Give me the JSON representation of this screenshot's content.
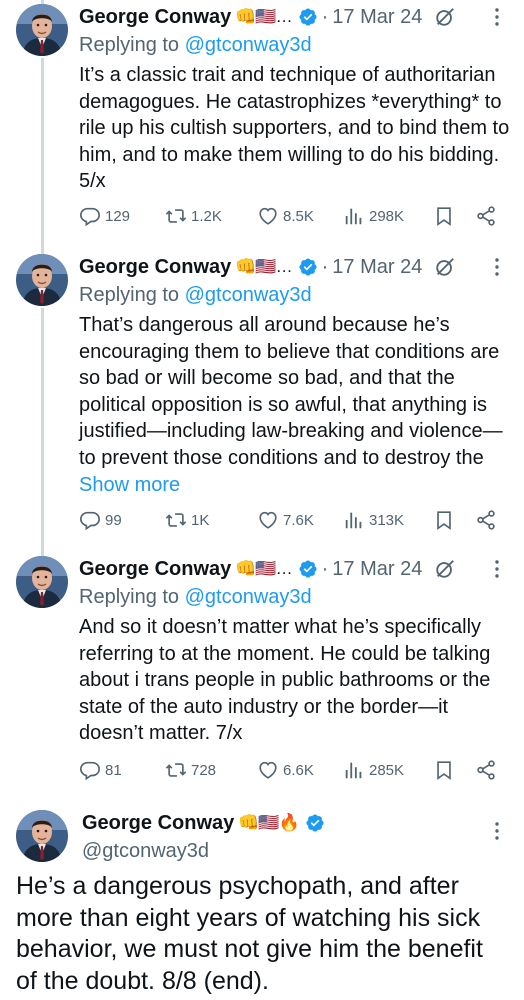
{
  "author": {
    "name": "George Conway",
    "emoji_truncated": "👊🇺🇸…",
    "emoji_full": "👊🇺🇸🔥",
    "handle": "@gtconway3d"
  },
  "colors": {
    "link": "#1d9bf0",
    "secondary_text": "#536471",
    "thread_line": "#cfd9de"
  },
  "tweets": [
    {
      "date": "17 Mar 24",
      "reply_prefix": "Replying to",
      "reply_handle": "@gtconway3d",
      "text": "It’s a classic trait and technique of authoritarian demagogues.  He catastrophizes *everything* to rile up his cultish supporters, and to bind them to him, and to make them willing to do his bidding.  5/x",
      "show_more": "",
      "replies": "129",
      "reposts": "1.2K",
      "likes": "8.5K",
      "views": "298K"
    },
    {
      "date": "17 Mar 24",
      "reply_prefix": "Replying to",
      "reply_handle": "@gtconway3d",
      "text": "That’s dangerous all around because he’s encouraging them to believe that conditions are so bad or will become so bad, and that the political opposition is so awful, that anything is justified—including law-breaking and violence—to prevent those conditions and to destroy the",
      "show_more": "Show more",
      "replies": "99",
      "reposts": "1K",
      "likes": "7.6K",
      "views": "313K"
    },
    {
      "date": "17 Mar 24",
      "reply_prefix": "Replying to",
      "reply_handle": "@gtconway3d",
      "text": "And so it doesn’t matter what he’s specifically referring to at the moment.  He could be talking about i trans people in public bathrooms or the state of the auto industry or the border—it doesn’t matter.  7/x",
      "show_more": "",
      "replies": "81",
      "reposts": "728",
      "likes": "6.6K",
      "views": "285K"
    }
  ],
  "final_tweet": {
    "text": "He’s a dangerous psychopath, and after more than eight years of watching his sick behavior, we must not give him the benefit of the doubt.  8/8 (end)."
  },
  "icons": {
    "verified": "verified-badge-icon",
    "grok": "grok-icon",
    "more": "more-options-icon",
    "reply": "reply-icon",
    "repost": "repost-icon",
    "like": "like-icon",
    "views": "views-icon",
    "bookmark": "bookmark-icon",
    "share": "share-icon"
  }
}
